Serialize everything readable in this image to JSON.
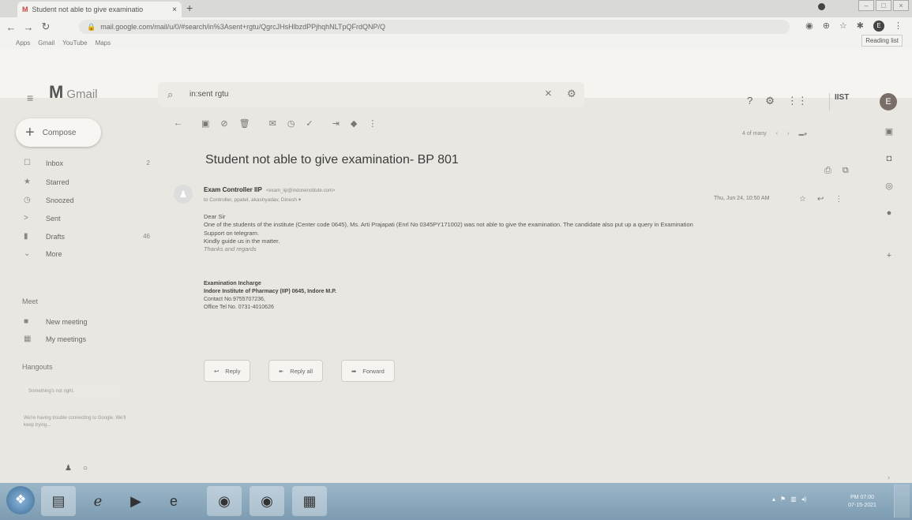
{
  "browser": {
    "tab_title": "Student not able to give examinatio",
    "tab_favicon": "M",
    "tab_close": "×",
    "new_tab": "+",
    "url": "mail.google.com/mail/u/0/#search/in%3Asent+rgtu/QgrcJHsHlbzdPPjhqhNLTpQFrdQNP/Q",
    "bookmarks": [
      "Apps",
      "Gmail",
      "YouTube",
      "Maps"
    ],
    "reading_list": "Reading list",
    "avatar": "E"
  },
  "gmail": {
    "logo": "M",
    "product": "Gmail",
    "search_value": "in:sent rgtu",
    "compose": "Compose",
    "nav": [
      {
        "icon": "☐",
        "label": "Inbox",
        "count": "2"
      },
      {
        "icon": "★",
        "label": "Starred",
        "count": ""
      },
      {
        "icon": "◷",
        "label": "Snoozed",
        "count": ""
      },
      {
        "icon": ">",
        "label": "Sent",
        "count": ""
      },
      {
        "icon": "▮",
        "label": "Drafts",
        "count": "46"
      },
      {
        "icon": "⌄",
        "label": "More",
        "count": ""
      }
    ],
    "meet_heading": "Meet",
    "meet": [
      {
        "icon": "■",
        "label": "New meeting"
      },
      {
        "icon": "▦",
        "label": "My meetings"
      }
    ],
    "hangouts_heading": "Hangouts",
    "hangouts_status": "Something's not right.",
    "hangouts_msg": "We're having trouble connecting to Google. We'll keep trying...",
    "header_logo_text": "IIST",
    "avatar": "E"
  },
  "message": {
    "pager": "4 of many",
    "subject": "Student not able to give examination- BP 801",
    "sender_name": "Exam Controller IIP",
    "sender_email": "<exam_iip@indoreinstitute.com>",
    "recipients": "to Controller, ppatel, akashyadav, Dinesh",
    "date": "Thu, Jun 24, 10:50 AM",
    "body": [
      "Dear Sir",
      "One of the students of the institute (Center code 0645), Ms. Arti Prajapati (Enrl No 0345PY171002) was not able to give the examination. The candidate also put up a query in Examination",
      "Support on telegram.",
      "Kindly guide us in the matter."
    ],
    "closing": "Thanks and regards",
    "sig_title": "Examination Incharge",
    "sig_org": "Indore Institute of Pharmacy (IIP) 0645, Indore M.P.",
    "sig_contact": "Contact No.9755707236,",
    "sig_office": "Office Tel No. 0731-4010626",
    "reply": "Reply",
    "reply_all": "Reply all",
    "forward": "Forward"
  },
  "taskbar": {
    "time": "PM 07:00",
    "date": "07-15-2021"
  }
}
